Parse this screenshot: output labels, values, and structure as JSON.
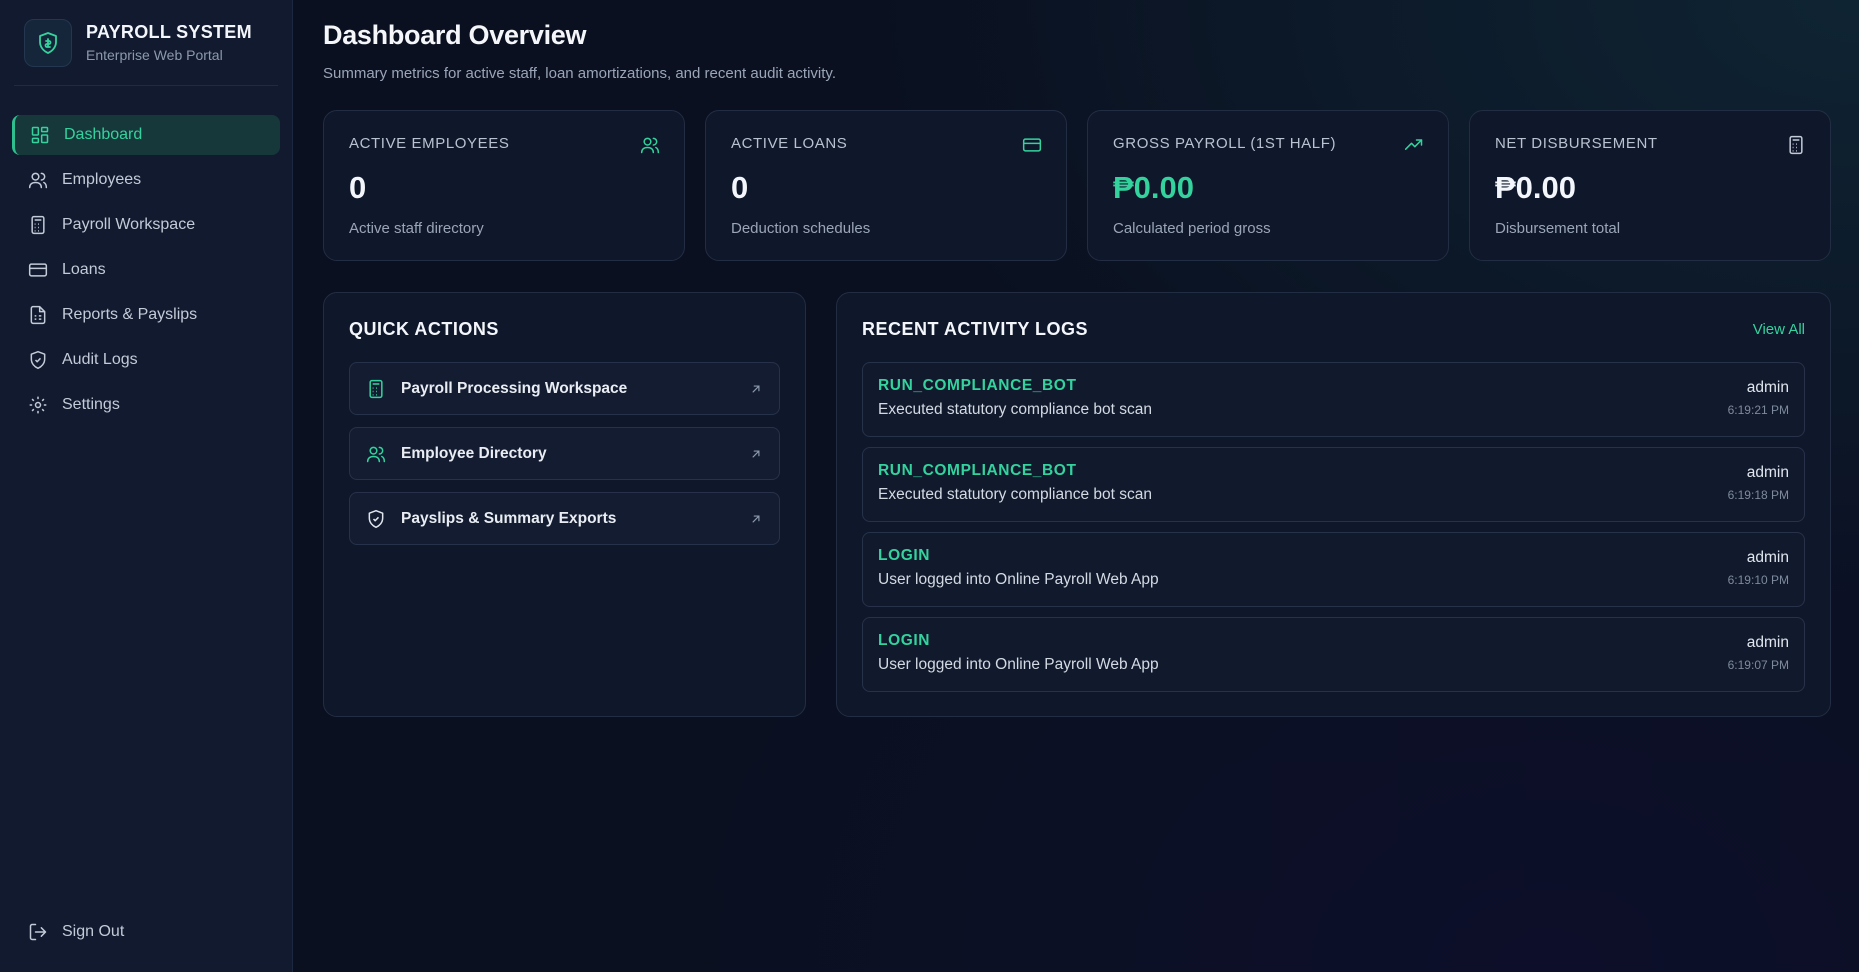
{
  "brand": {
    "title": "PAYROLL SYSTEM",
    "subtitle": "Enterprise Web Portal"
  },
  "sidebar": {
    "items": [
      {
        "label": "Dashboard",
        "icon": "grid-icon",
        "active": true
      },
      {
        "label": "Employees",
        "icon": "users-icon"
      },
      {
        "label": "Payroll Workspace",
        "icon": "calculator-icon"
      },
      {
        "label": "Loans",
        "icon": "card-icon"
      },
      {
        "label": "Reports & Payslips",
        "icon": "report-icon"
      },
      {
        "label": "Audit Logs",
        "icon": "shield-icon"
      },
      {
        "label": "Settings",
        "icon": "gear-icon"
      }
    ],
    "sign_out": "Sign Out"
  },
  "header": {
    "title": "Dashboard Overview",
    "subtitle": "Summary metrics for active staff, loan amortizations, and recent audit activity."
  },
  "stats": [
    {
      "label": "ACTIVE EMPLOYEES",
      "value": "0",
      "desc": "Active staff directory",
      "icon": "users-icon"
    },
    {
      "label": "ACTIVE LOANS",
      "value": "0",
      "desc": "Deduction schedules",
      "icon": "card-icon"
    },
    {
      "label": "GROSS PAYROLL (1ST HALF)",
      "value": "₱0.00",
      "desc": "Calculated period gross",
      "icon": "trend-up-icon"
    },
    {
      "label": "NET DISBURSEMENT",
      "value": "₱0.00",
      "desc": "Disbursement total",
      "icon": "calculator-icon"
    }
  ],
  "quick_actions": {
    "title": "QUICK ACTIONS",
    "items": [
      {
        "label": "Payroll Processing Workspace",
        "icon": "calculator-icon"
      },
      {
        "label": "Employee Directory",
        "icon": "users-icon"
      },
      {
        "label": "Payslips & Summary Exports",
        "icon": "shield-icon"
      }
    ]
  },
  "activity": {
    "title": "RECENT ACTIVITY LOGS",
    "view_all": "View All",
    "logs": [
      {
        "action": "RUN_COMPLIANCE_BOT",
        "desc": "Executed statutory compliance bot scan",
        "user": "admin",
        "time": "6:19:21 PM"
      },
      {
        "action": "RUN_COMPLIANCE_BOT",
        "desc": "Executed statutory compliance bot scan",
        "user": "admin",
        "time": "6:19:18 PM"
      },
      {
        "action": "LOGIN",
        "desc": "User logged into Online Payroll Web App",
        "user": "admin",
        "time": "6:19:10 PM"
      },
      {
        "action": "LOGIN",
        "desc": "User logged into Online Payroll Web App",
        "user": "admin",
        "time": "6:19:07 PM"
      }
    ]
  },
  "colors": {
    "accent": "#34d39e",
    "background": "#0a1020",
    "card": "#0f172a",
    "sidebar": "#111a2e"
  }
}
